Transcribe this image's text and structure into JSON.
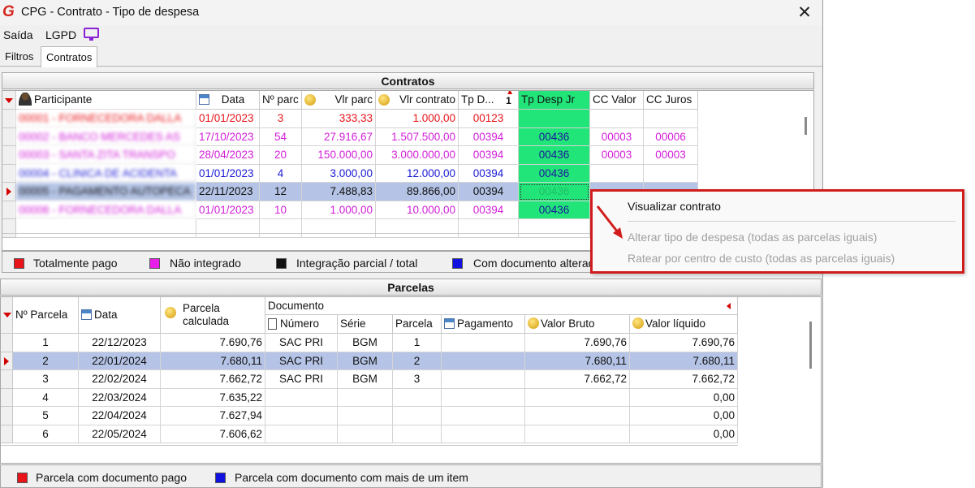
{
  "window": {
    "title": "CPG - Contrato - Tipo de despesa",
    "close": "✕",
    "logo_letter": "G"
  },
  "menu": {
    "saida": "Saída",
    "lgpd": "LGPD"
  },
  "tabs": [
    {
      "label": "Filtros"
    },
    {
      "label": "Contratos"
    }
  ],
  "contratos": {
    "title": "Contratos",
    "columns": [
      "Participante",
      "Data",
      "Nº parc",
      "Vlr parc",
      "Vlr contrato",
      "Tp D...",
      "Tp Desp Jr",
      "CC Valor",
      "CC Juros"
    ],
    "sort_indicator": "1",
    "rows": [
      {
        "participante": "00001 - FORNECEDORA DALLA",
        "data": "01/01/2023",
        "nparc": "3",
        "vlrparc": "333,33",
        "vlrcontrato": "1.000,00",
        "tpd": "00123",
        "tpdespjr": "",
        "ccvalor": "",
        "ccjuros": "",
        "color": "#e8141a"
      },
      {
        "participante": "00002 - BANCO MERCEDES AS",
        "data": "17/10/2023",
        "nparc": "54",
        "vlrparc": "27.916,67",
        "vlrcontrato": "1.507.500,00",
        "tpd": "00394",
        "tpdespjr": "00436",
        "ccvalor": "00003",
        "ccjuros": "00006",
        "color": "#d21ed8"
      },
      {
        "participante": "00003 - SANTA ZITA TRANSPO",
        "data": "28/04/2023",
        "nparc": "20",
        "vlrparc": "150.000,00",
        "vlrcontrato": "3.000.000,00",
        "tpd": "00394",
        "tpdespjr": "00436",
        "ccvalor": "00003",
        "ccjuros": "00003",
        "color": "#d21ed8"
      },
      {
        "participante": "00004 - CLINICA DE ACIDENTA",
        "data": "01/01/2023",
        "nparc": "4",
        "vlrparc": "3.000,00",
        "vlrcontrato": "12.000,00",
        "tpd": "00394",
        "tpdespjr": "00436",
        "ccvalor": "",
        "ccjuros": "",
        "color": "#1a1ad4"
      },
      {
        "participante": "00005 - PAGAMENTO AUTOPECA",
        "data": "22/11/2023",
        "nparc": "12",
        "vlrparc": "7.488,83",
        "vlrcontrato": "89.866,00",
        "tpd": "00394",
        "tpdespjr": "00436",
        "ccvalor": "",
        "ccjuros": "",
        "color": "#111111"
      },
      {
        "participante": "00006 - FORNECEDORA DALLA",
        "data": "01/01/2023",
        "nparc": "10",
        "vlrparc": "1.000,00",
        "vlrcontrato": "10.000,00",
        "tpd": "00394",
        "tpdespjr": "00436",
        "ccvalor": "",
        "ccjuros": "",
        "color": "#d21ed8"
      }
    ],
    "selected_row": 4,
    "legend": [
      {
        "label": "Totalmente pago",
        "color": "#e8141a"
      },
      {
        "label": "Não integrado",
        "color": "#e81ee8"
      },
      {
        "label": "Integração parcial / total",
        "color": "#111111"
      },
      {
        "label": "Com documento alterado",
        "color": "#1212e0"
      }
    ]
  },
  "context_menu": {
    "items": [
      {
        "label": "Visualizar contrato",
        "enabled": true
      },
      {
        "label": "Alterar tipo de despesa (todas as parcelas iguais)",
        "enabled": false
      },
      {
        "label": "Ratear por centro de custo (todas as parcelas iguais)",
        "enabled": false
      }
    ]
  },
  "parcelas": {
    "title": "Parcelas",
    "columns": {
      "nparcela": "Nº Parcela",
      "data": "Data",
      "parcela_calc_1": "Parcela",
      "parcela_calc_2": "calculada",
      "documento": "Documento",
      "numero": "Número",
      "serie": "Série",
      "parcela": "Parcela",
      "pagamento": "Pagamento",
      "valor_bruto": "Valor Bruto",
      "valor_liquido": "Valor líquido"
    },
    "rows": [
      {
        "n": "1",
        "data": "22/12/2023",
        "calc": "7.690,76",
        "numero": "SAC PRI",
        "serie": "BGM",
        "parcela": "1",
        "pagamento": "",
        "bruto": "7.690,76",
        "liquido": "7.690,76"
      },
      {
        "n": "2",
        "data": "22/01/2024",
        "calc": "7.680,11",
        "numero": "SAC PRI",
        "serie": "BGM",
        "parcela": "2",
        "pagamento": "",
        "bruto": "7.680,11",
        "liquido": "7.680,11"
      },
      {
        "n": "3",
        "data": "22/02/2024",
        "calc": "7.662,72",
        "numero": "SAC PRI",
        "serie": "BGM",
        "parcela": "3",
        "pagamento": "",
        "bruto": "7.662,72",
        "liquido": "7.662,72"
      },
      {
        "n": "4",
        "data": "22/03/2024",
        "calc": "7.635,22",
        "numero": "",
        "serie": "",
        "parcela": "",
        "pagamento": "",
        "bruto": "",
        "liquido": "0,00"
      },
      {
        "n": "5",
        "data": "22/04/2024",
        "calc": "7.627,94",
        "numero": "",
        "serie": "",
        "parcela": "",
        "pagamento": "",
        "bruto": "",
        "liquido": "0,00"
      },
      {
        "n": "6",
        "data": "22/05/2024",
        "calc": "7.606,62",
        "numero": "",
        "serie": "",
        "parcela": "",
        "pagamento": "",
        "bruto": "",
        "liquido": "0,00"
      }
    ],
    "selected_row": 1,
    "legend": [
      {
        "label": "Parcela com documento pago",
        "color": "#e8141a"
      },
      {
        "label": "Parcela com documento com mais de um item",
        "color": "#1212e0"
      }
    ]
  },
  "colors": {
    "highlight_column": "#22e57a",
    "selection": "#b5c4e6",
    "annotation": "#d11c1c"
  }
}
